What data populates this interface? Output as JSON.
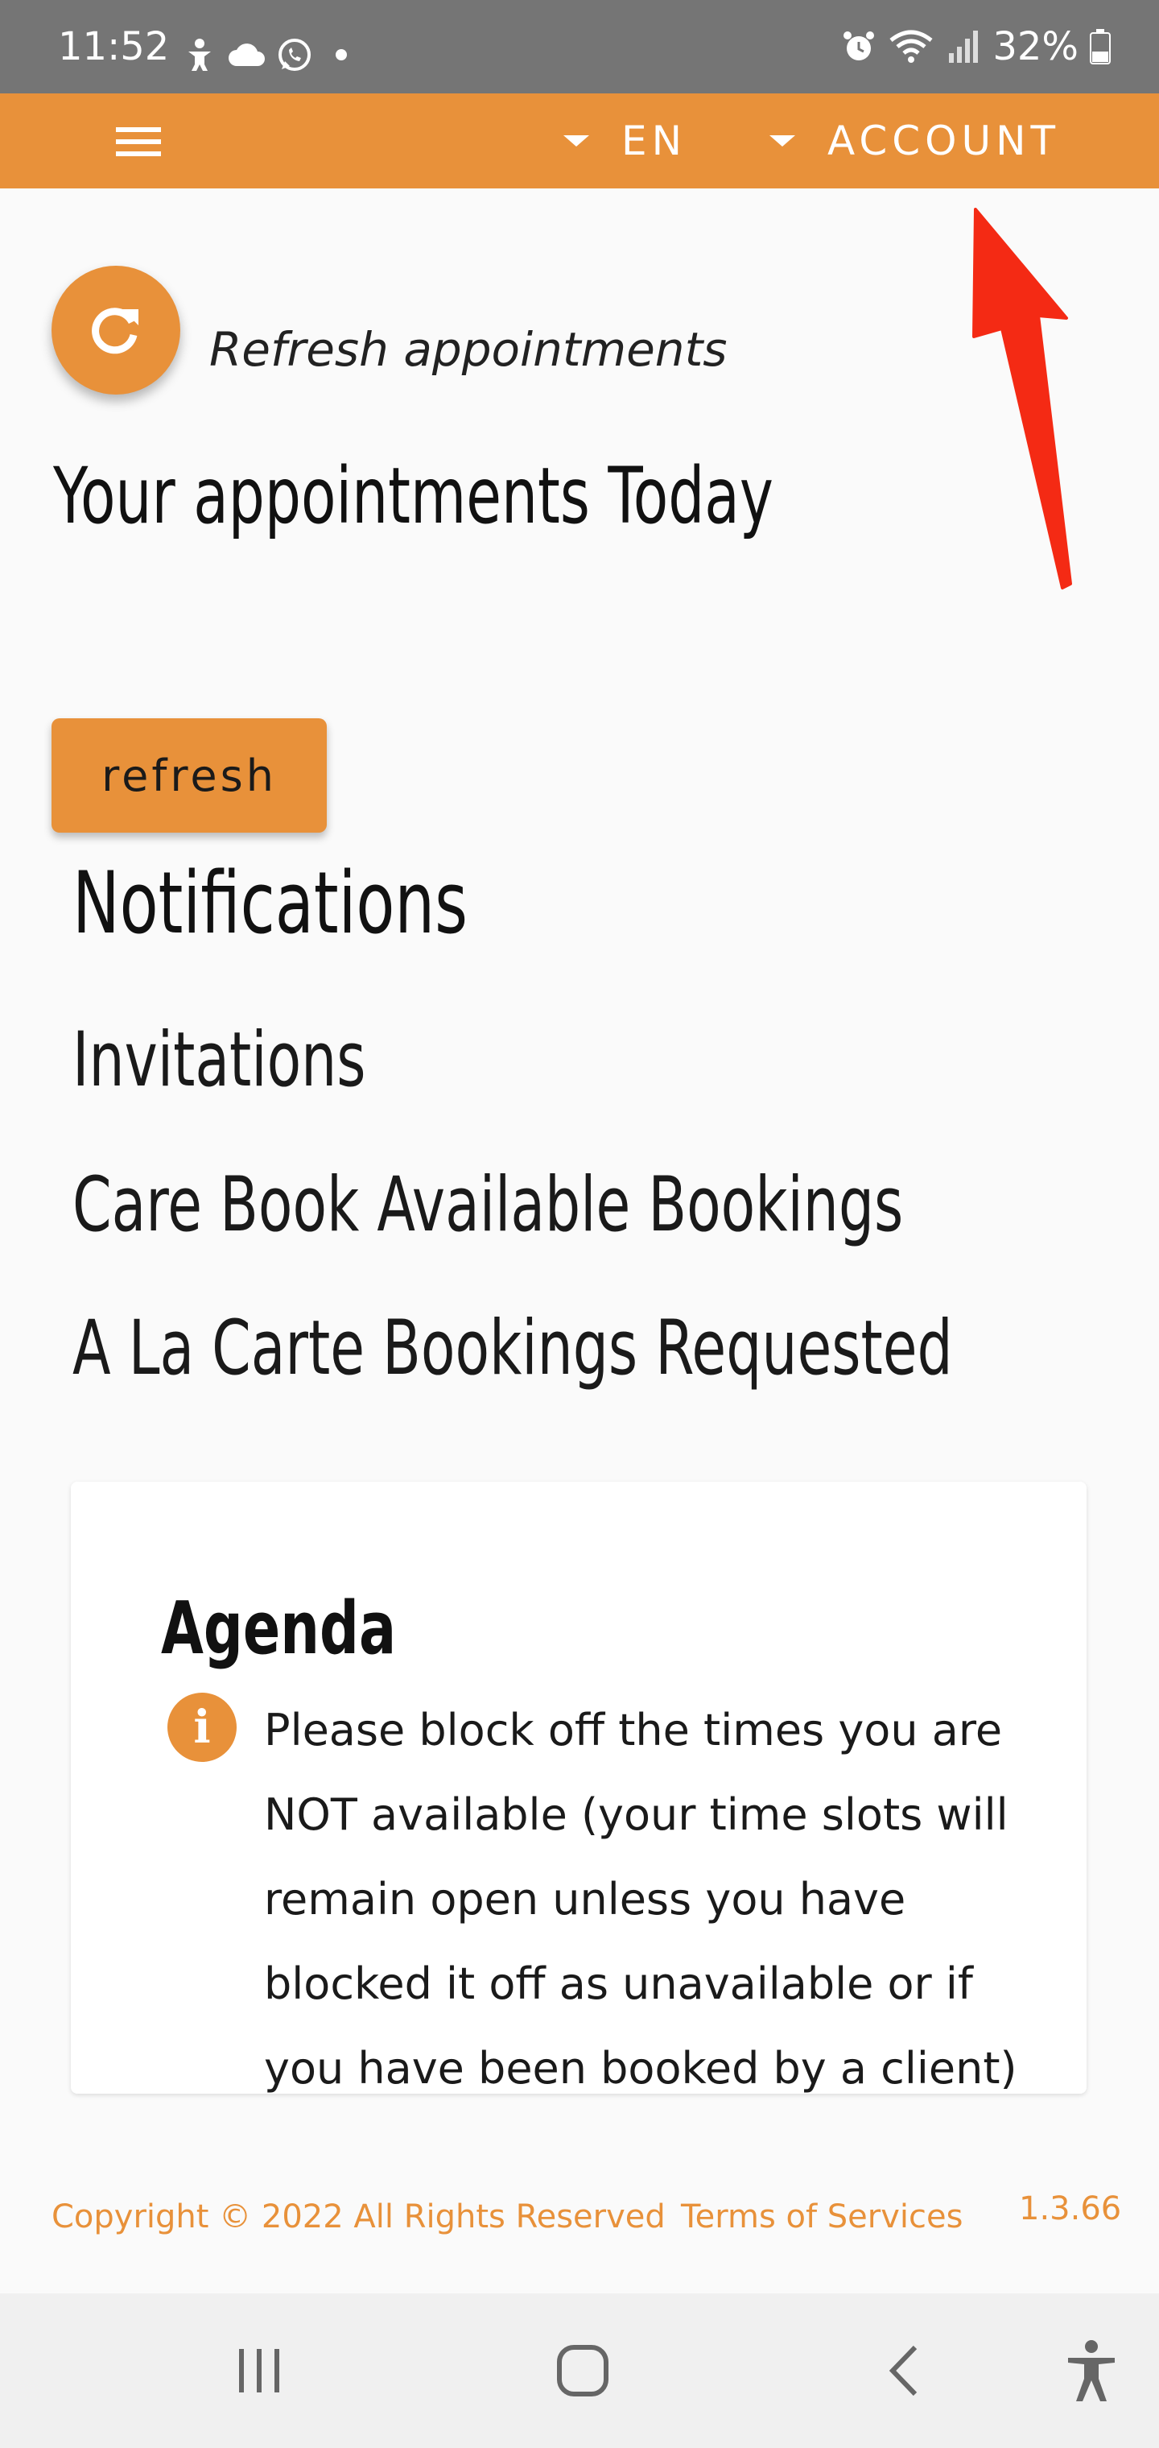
{
  "status_bar": {
    "time": "11:52",
    "battery": "32%",
    "icons_left": [
      "accessibility-person-icon",
      "cloud-icon",
      "whatsapp-icon",
      "dot-icon"
    ],
    "icons_right": [
      "alarm-icon",
      "wifi-icon",
      "signal-icon",
      "battery-icon"
    ]
  },
  "app_bar": {
    "language": "EN",
    "account": "ACCOUNT",
    "menu_icon": "hamburger-menu-icon"
  },
  "refresh_fab": {
    "label": "Refresh appointments",
    "icon": "refresh-icon"
  },
  "main": {
    "appointments_title": "Your appointments Today",
    "refresh_button": "refresh",
    "notifications_title": "Notifications",
    "items": [
      "Invitations",
      "Care Book Available Bookings",
      "A La Carte Bookings Requested"
    ]
  },
  "agenda": {
    "title": "Agenda",
    "info_text": "Please block off the times you are NOT available (your time slots will remain open unless you have blocked it off as unavailable or if you have been booked by a client)"
  },
  "footer": {
    "copyright": "Copyright © 2022 All Rights Reserved",
    "terms": "Terms of Services",
    "version": "1.3.66"
  },
  "colors": {
    "accent": "#e8913a",
    "status_bar": "#757575",
    "annotation": "#f42a14"
  }
}
